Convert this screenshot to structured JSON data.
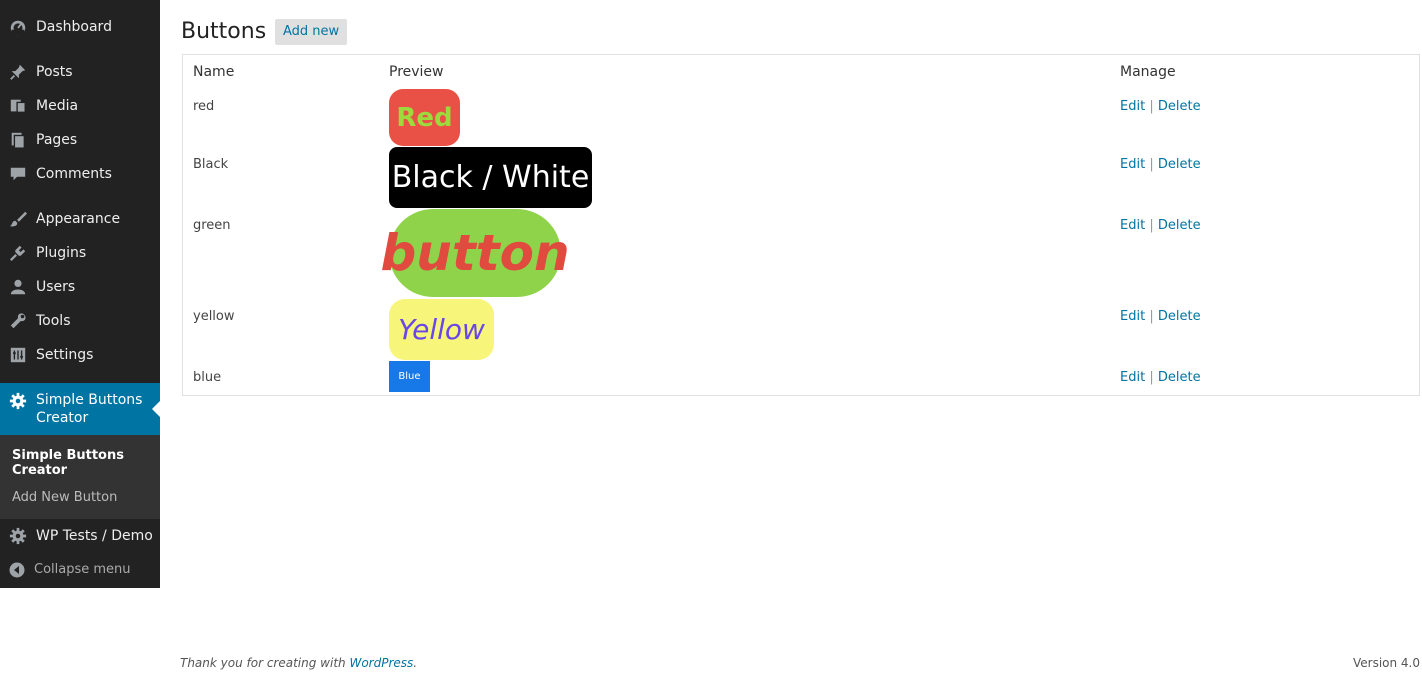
{
  "menu": {
    "items": [
      {
        "label": "Dashboard",
        "icon": "dashboard-icon"
      },
      {
        "label": "Posts",
        "icon": "pin-icon"
      },
      {
        "label": "Media",
        "icon": "media-icon"
      },
      {
        "label": "Pages",
        "icon": "pages-icon"
      },
      {
        "label": "Comments",
        "icon": "comment-icon"
      },
      {
        "label": "Appearance",
        "icon": "brush-icon"
      },
      {
        "label": "Plugins",
        "icon": "plug-icon"
      },
      {
        "label": "Users",
        "icon": "user-icon"
      },
      {
        "label": "Tools",
        "icon": "wrench-icon"
      },
      {
        "label": "Settings",
        "icon": "settings-icon"
      },
      {
        "label": "Simple Buttons Creator",
        "icon": "gear-icon"
      },
      {
        "label": "WP Tests / Demo",
        "icon": "gear-icon"
      }
    ],
    "submenu": [
      "Simple Buttons Creator",
      "Add New Button"
    ],
    "collapse_label": "Collapse menu"
  },
  "page": {
    "title": "Buttons",
    "add_new_label": "Add new"
  },
  "table": {
    "columns": [
      "Name",
      "Preview",
      "Manage"
    ],
    "rows": [
      {
        "name": "red",
        "preview": "Red",
        "bg": "#ea5146",
        "fg": "#9bdb3c"
      },
      {
        "name": "Black",
        "preview": "Black / White",
        "bg": "#000000",
        "fg": "#ffffff"
      },
      {
        "name": "green",
        "preview": "button",
        "bg": "#8fd34a",
        "fg": "#e04a3f"
      },
      {
        "name": "yellow",
        "preview": "Yellow",
        "bg": "#f7f57a",
        "fg": "#6a45e8"
      },
      {
        "name": "blue",
        "preview": "Blue",
        "bg": "#1778e8",
        "fg": "#ffffff"
      }
    ],
    "edit_label": "Edit",
    "separator": "|",
    "delete_label": "Delete"
  },
  "footer": {
    "thanks_text": "Thank you for creating with",
    "wp_link": "WordPress",
    "thanks_end": ".",
    "version": "Version 4.0"
  },
  "colors": {
    "menu_bg": "#222222",
    "menu_current_bg": "#0074a2",
    "submenu_bg": "#333333",
    "link": "#0074a2"
  }
}
